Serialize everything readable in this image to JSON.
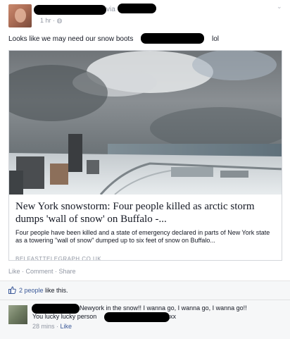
{
  "post": {
    "via": "via",
    "time": "1 hr · ◍",
    "status_text": "Looks like we may need our snow boots",
    "status_suffix": "lol",
    "chevron": "⌄"
  },
  "link_card": {
    "title": "New York snowstorm: Four people killed as arctic storm dumps 'wall of snow' on Buffalo -...",
    "description": "Four people have been killed and a state of emergency declared in parts of New York state as a towering \"wall of snow\" dumped up to six feet of snow on Buffalo...",
    "domain": "BELFASTTELEGRAPH.CO.UK"
  },
  "actions": {
    "like": "Like",
    "comment": "Comment",
    "share": "Share",
    "separator": " · "
  },
  "likes": {
    "count_text": "2 people",
    "suffix": " like this."
  },
  "comment": {
    "text_line1": "Newyork in the snow!! I wanna go, I wanna go, I wanna go!!",
    "text_line2": "You lucky lucky person",
    "text_suffix": "xx",
    "time": "28 mins",
    "separator": " · ",
    "like": "Like"
  },
  "colors": {
    "link": "#3b5998",
    "meta": "#9197a3",
    "text": "#141823"
  }
}
